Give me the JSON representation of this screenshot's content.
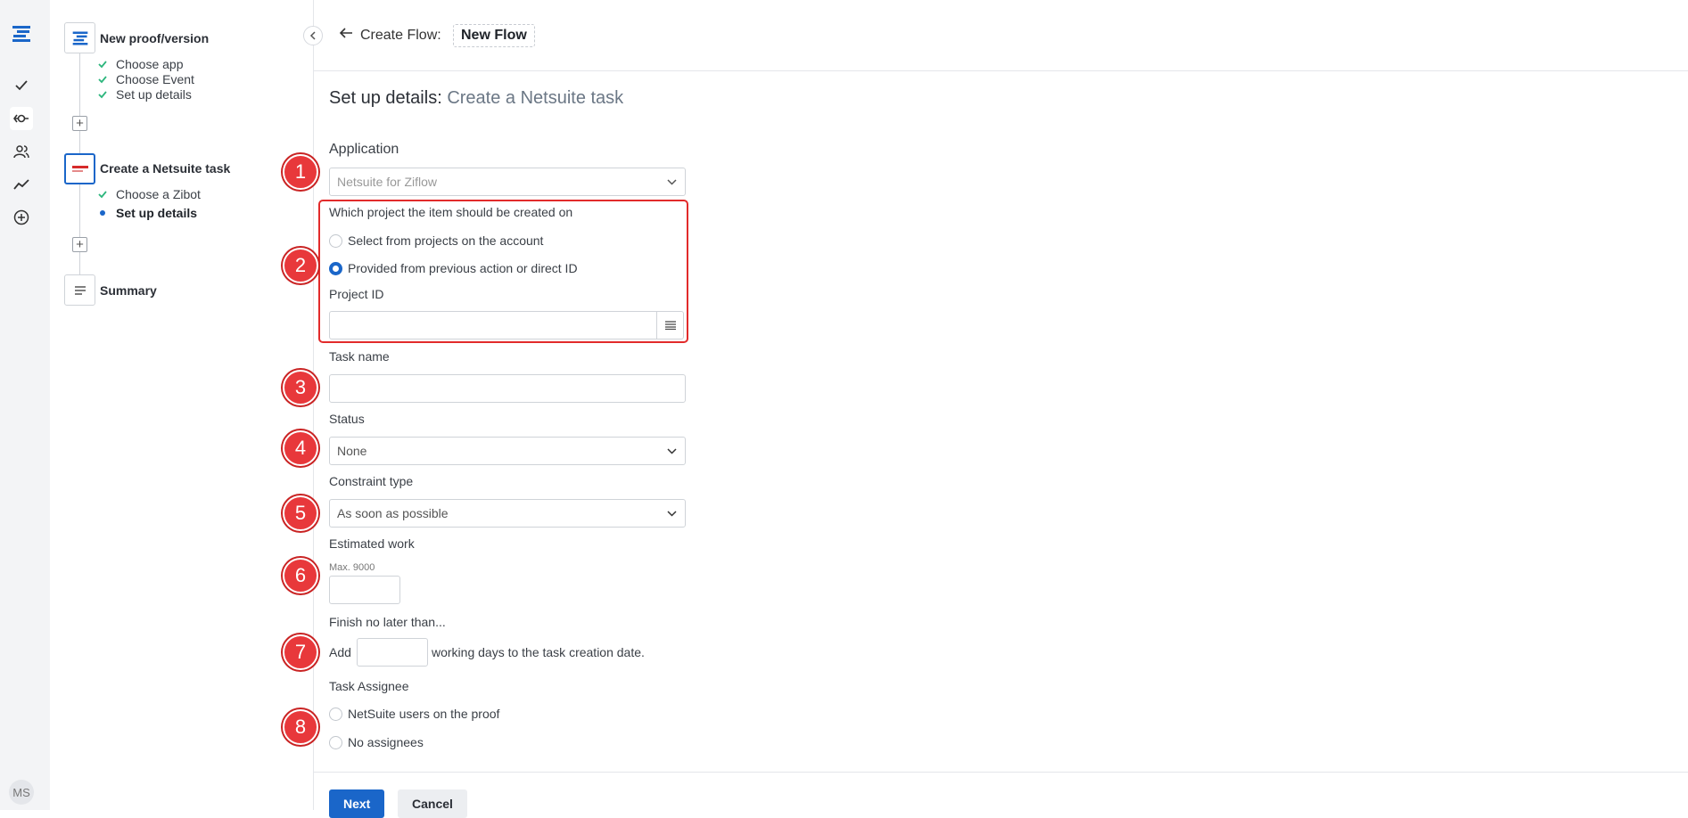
{
  "rail": {
    "avatar_initials": "MS"
  },
  "steps_panel": {
    "steps": [
      {
        "title": "New proof/version",
        "substeps": [
          "Choose app",
          "Choose Event",
          "Set up details"
        ]
      },
      {
        "title": "Create a Netsuite task",
        "substeps": [
          "Choose a Zibot",
          "Set up details"
        ]
      },
      {
        "title": "Summary",
        "substeps": []
      }
    ]
  },
  "header": {
    "label": "Create Flow:",
    "flow_name": "New Flow"
  },
  "form": {
    "title_prefix": "Set up details:",
    "title_suffix": "Create a Netsuite task",
    "application_label": "Application",
    "application_value": "Netsuite for Ziflow",
    "project_question": "Which project the item should be created on",
    "project_option_1": "Select from projects on the account",
    "project_option_2": "Provided from previous action or direct ID",
    "project_selected": 2,
    "project_id_label": "Project ID",
    "task_name_label": "Task name",
    "status_label": "Status",
    "status_value": "None",
    "constraint_label": "Constraint type",
    "constraint_value": "As soon as possible",
    "estimated_label": "Estimated work",
    "estimated_hint": "Max. 9000",
    "finish_label": "Finish no later than...",
    "finish_prefix": "Add",
    "finish_suffix": "working days to the task creation date.",
    "assignee_label": "Task Assignee",
    "assignee_option_1": "NetSuite users on the proof",
    "assignee_option_2": "No assignees"
  },
  "markers": [
    "1",
    "2",
    "3",
    "4",
    "5",
    "6",
    "7",
    "8"
  ],
  "footer": {
    "next_label": "Next",
    "cancel_label": "Cancel"
  },
  "colors": {
    "accent": "#1a66c9",
    "highlight": "#e22b2b",
    "check": "#2cb67d"
  }
}
